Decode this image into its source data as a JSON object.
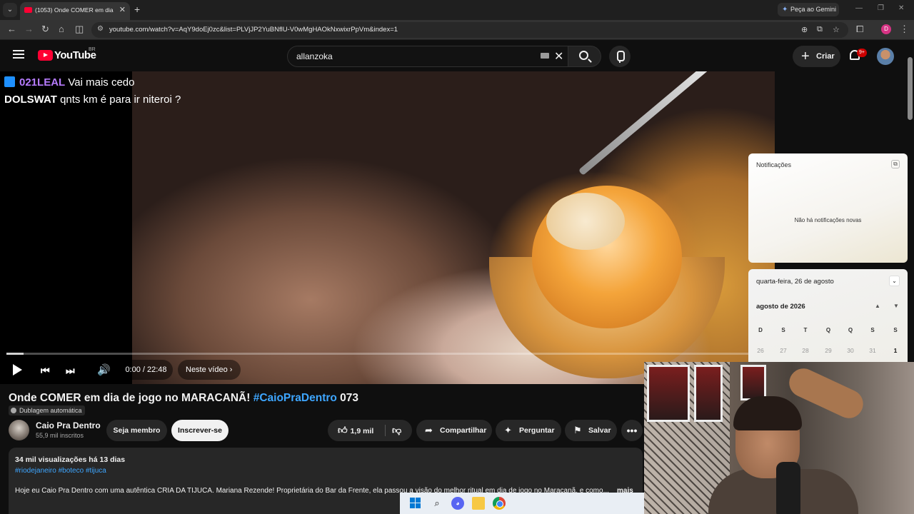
{
  "browser": {
    "tab_title": "(1053) Onde COMER em dia de jogo no MARACANÃ! #CaioPraDentro 073",
    "gemini_label": "Peça ao Gemini",
    "url": "youtube.com/watch?v=AqY9doEj0zc&list=PLVjJP2YuBNflU-V0wMgHAOkNxwixrPpVm&index=1",
    "profile_initial": "D"
  },
  "youtube": {
    "logo_text": "YouTube",
    "logo_country": "BR",
    "search_value": "allanzoka",
    "create_label": "Criar",
    "notifications_badge": "9+"
  },
  "player": {
    "chat": [
      {
        "user": "021LEAL",
        "message": "Vai mais cedo"
      },
      {
        "user": "DOLSWAT",
        "message": "qnts km é para ir niteroi ?"
      }
    ],
    "time": "0:00 / 22:48",
    "chapter_label": "Neste vídeo",
    "progress_fraction": 0.0
  },
  "video": {
    "title_main": "Onde COMER em dia de jogo no MARACANÃ! ",
    "title_hashtag": "#CaioPraDentro",
    "title_suffix": " 073",
    "dub_label": "Dublagem automática",
    "channel_name": "Caio Pra Dentro",
    "channel_subs": "55,9 mil inscritos",
    "member_label": "Seja membro",
    "subscribe_label": "Inscrever-se",
    "likes": "1,9 mil",
    "share_label": "Compartilhar",
    "ask_label": "Perguntar",
    "save_label": "Salvar",
    "more_label": "•••",
    "description": {
      "meta": "34 mil visualizações  há 13 dias",
      "tags": "#riodejaneiro #boteco #tijuca",
      "text": "Hoje eu Caio Pra Dentro com uma autêntica CRIA DA TIJUCA. Mariana Rezende! Proprietária do Bar da Frente, ela passou a visão do melhor ritual em dia de jogo no Maracanã, e como...",
      "more": "mais"
    }
  },
  "windows": {
    "notifications_title": "Notificações",
    "notifications_empty": "Não há notificações novas",
    "calendar_date": "quarta-feira, 26 de agosto",
    "calendar_month": "agosto de 2026",
    "weekdays": [
      "D",
      "S",
      "T",
      "Q",
      "Q",
      "S",
      "S"
    ],
    "first_row": [
      "26",
      "27",
      "28",
      "29",
      "30",
      "31",
      "1"
    ]
  }
}
